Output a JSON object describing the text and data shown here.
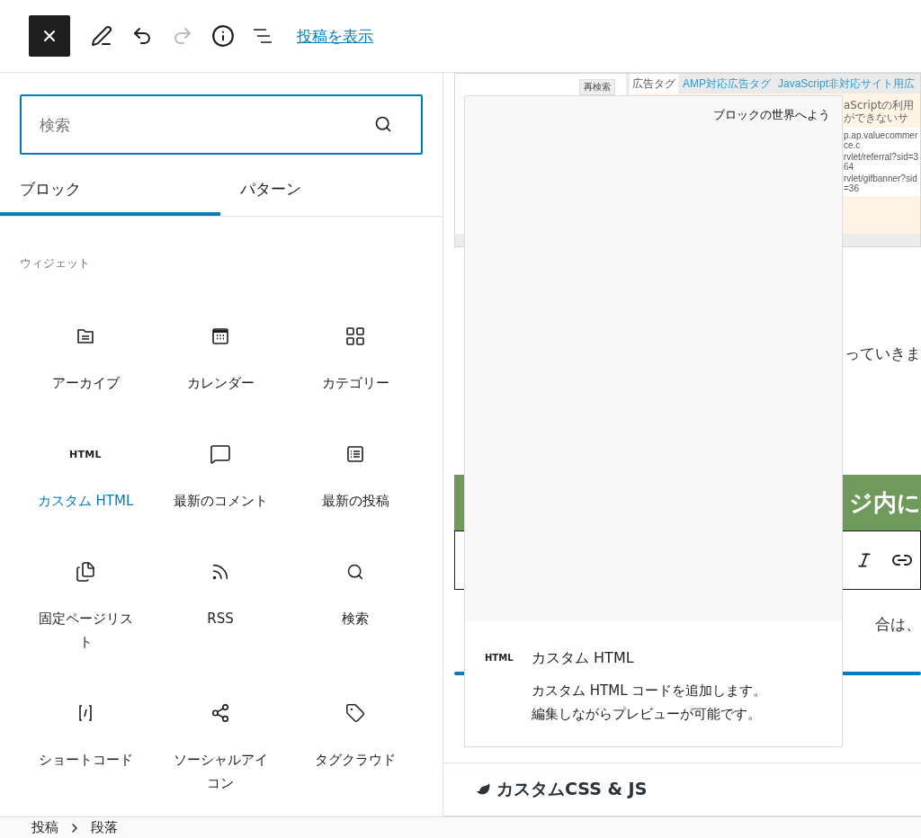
{
  "toolbar": {
    "view_post": "投稿を表示",
    "redo": {
      "disabled": true
    }
  },
  "inserter": {
    "search": {
      "placeholder": "検索"
    },
    "tabs": [
      {
        "label": "ブロック",
        "selected": true
      },
      {
        "label": "パターン",
        "selected": false
      }
    ],
    "category": "ウィジェット",
    "blocks": [
      {
        "label": "アーカイブ",
        "kind": "archive",
        "selected": false
      },
      {
        "label": "カレンダー",
        "kind": "calendar",
        "selected": false
      },
      {
        "label": "カテゴリー",
        "kind": "categories",
        "selected": false
      },
      {
        "label": "カスタム HTML",
        "kind": "html",
        "icon_text": "HTML",
        "selected": true
      },
      {
        "label": "最新のコメント",
        "kind": "comment",
        "selected": false
      },
      {
        "label": "最新の投稿",
        "kind": "posts",
        "selected": false
      },
      {
        "label": "固定ページリスト",
        "kind": "pages",
        "selected": false
      },
      {
        "label": "RSS",
        "kind": "rss",
        "selected": false
      },
      {
        "label": "検索",
        "kind": "search",
        "selected": false
      },
      {
        "label": "ショートコード",
        "kind": "shortcode",
        "selected": false
      },
      {
        "label": "ソーシャルアイコン",
        "kind": "share",
        "selected": false
      },
      {
        "label": "タグクラウド",
        "kind": "tag",
        "selected": false
      }
    ]
  },
  "editor": {
    "embedded_screenshot": {
      "button": "再検索",
      "tabs": [
        {
          "label": "広告タグ",
          "selected": true
        },
        {
          "label": "AMP対応広告タグ",
          "selected": false
        },
        {
          "label": "JavaScript非対応サイト用広",
          "selected": false
        }
      ],
      "note": "aScriptの利用ができないサ",
      "code_lines": [
        "p.ap.valuecommerce.c",
        "rvlet/referral?sid=364",
        "rvlet/gifbanner?sid=36"
      ]
    },
    "paragraph_1": "っていきま",
    "heading": "ジ内に",
    "paragraph_2": "合は、"
  },
  "preview": {
    "preview_text": "ブロックの世界へよう",
    "icon_text": "HTML",
    "title": "カスタム HTML",
    "description": [
      "カスタム HTML コードを追加します。",
      "編集しながらプレビューが可能です。"
    ]
  },
  "meta_panel": {
    "title": "カスタムCSS & JS"
  },
  "breadcrumb": [
    "投稿",
    "段落"
  ]
}
